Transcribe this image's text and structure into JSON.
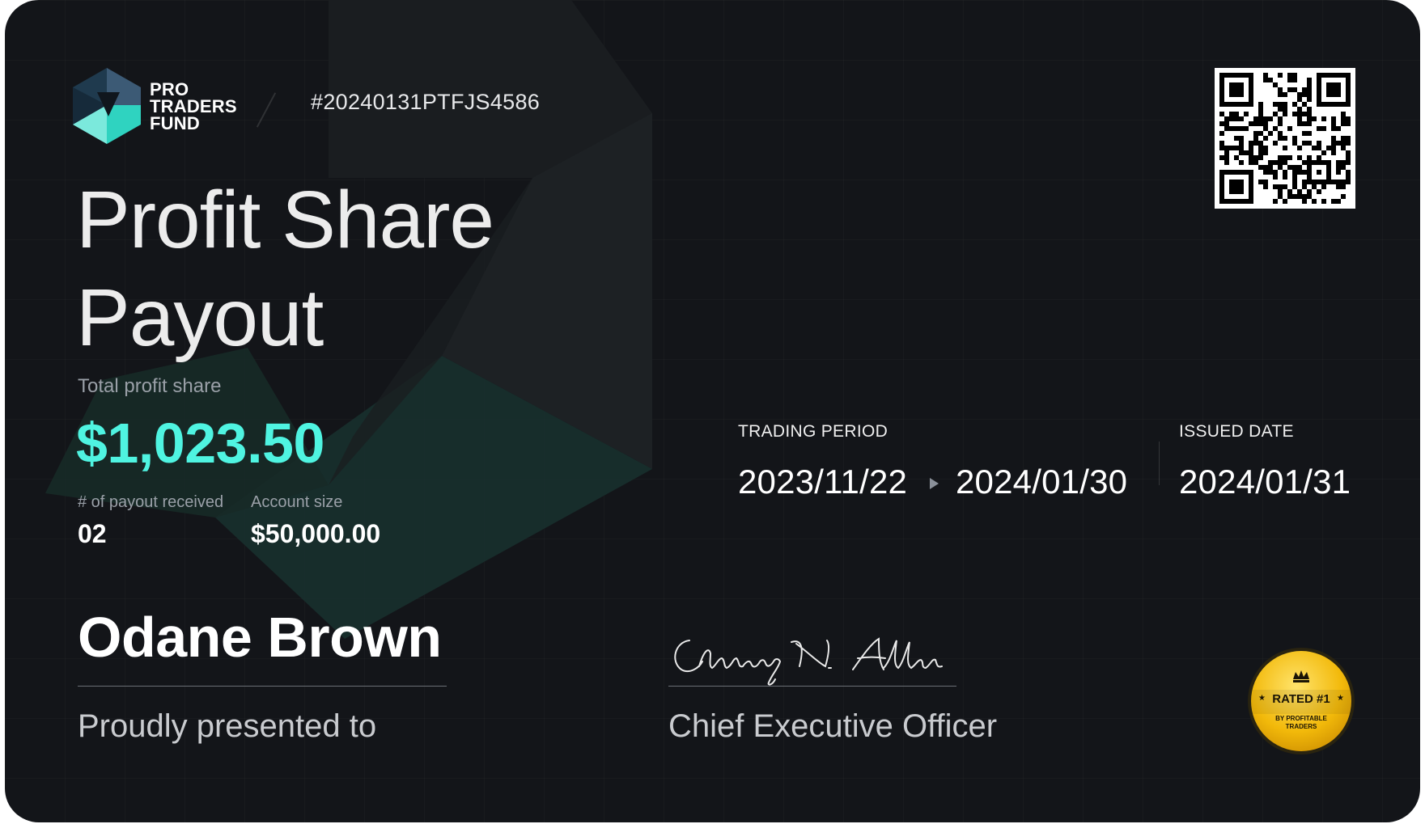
{
  "brand": {
    "logo_lines": [
      "PRO",
      "TRADERS",
      "FUND"
    ],
    "accent": "#4ff4e1"
  },
  "certificate": {
    "id": "#20240131PTFJS4586",
    "title_line1": "Profit Share",
    "title_line2": "Payout"
  },
  "payout": {
    "total_label": "Total profit share",
    "total_amount": "$1,023.50",
    "payouts_label": "# of payout received",
    "payouts_value": "02",
    "account_label": "Account size",
    "account_value": "$50,000.00"
  },
  "period": {
    "label": "TRADING PERIOD",
    "start": "2023/11/22",
    "end": "2024/01/30",
    "arrow_icon": "play-arrow-icon"
  },
  "issued": {
    "label": "ISSUED DATE",
    "date": "2024/01/31"
  },
  "recipient": {
    "name": "Odane Brown",
    "caption": "Proudly presented to"
  },
  "signatory": {
    "signature": "Chavez N. Allen",
    "role": "Chief Executive Officer"
  },
  "badge": {
    "title": "RATED #1",
    "subtitle_line1": "BY PROFITABLE",
    "subtitle_line2": "TRADERS",
    "icon": "crown-icon",
    "color": "#f5c10a"
  },
  "qr_code": {
    "icon": "qr-code-icon"
  }
}
